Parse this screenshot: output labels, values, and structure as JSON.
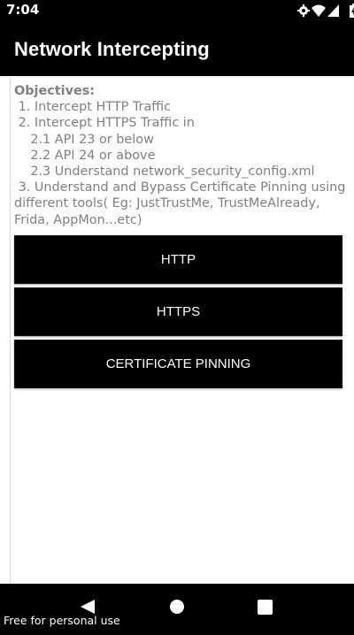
{
  "status_bar": {
    "time": "7:04",
    "icons": [
      "settings-gear-icon",
      "wifi-icon",
      "signal-icon",
      "battery-icon"
    ]
  },
  "app_bar": {
    "title": "Network Intercepting"
  },
  "objectives": {
    "heading": "Objectives:",
    "lines": [
      " 1. Intercept HTTP Traffic",
      " 2. Intercept HTTPS Traffic in",
      "    2.1 API 23 or below",
      "    2.2 API 24 or above",
      "    2.3 Understand network_security_config.xml",
      " 3. Understand and Bypass Certificate Pinning using different tools( Eg: JustTrustMe, TrustMeAlready, Frida, AppMon...etc)"
    ]
  },
  "buttons": {
    "http": "HTTP",
    "https": "HTTPS",
    "pinning": "CERTIFICATE PINNING"
  },
  "nav_bar": {
    "buttons": [
      "back-icon",
      "home-icon",
      "recents-icon"
    ]
  },
  "footer": {
    "note": "Free for personal use"
  },
  "colors": {
    "bar_background": "#000000",
    "objective_text": "#808080",
    "button_background": "#000000",
    "button_text": "#ffffff"
  }
}
